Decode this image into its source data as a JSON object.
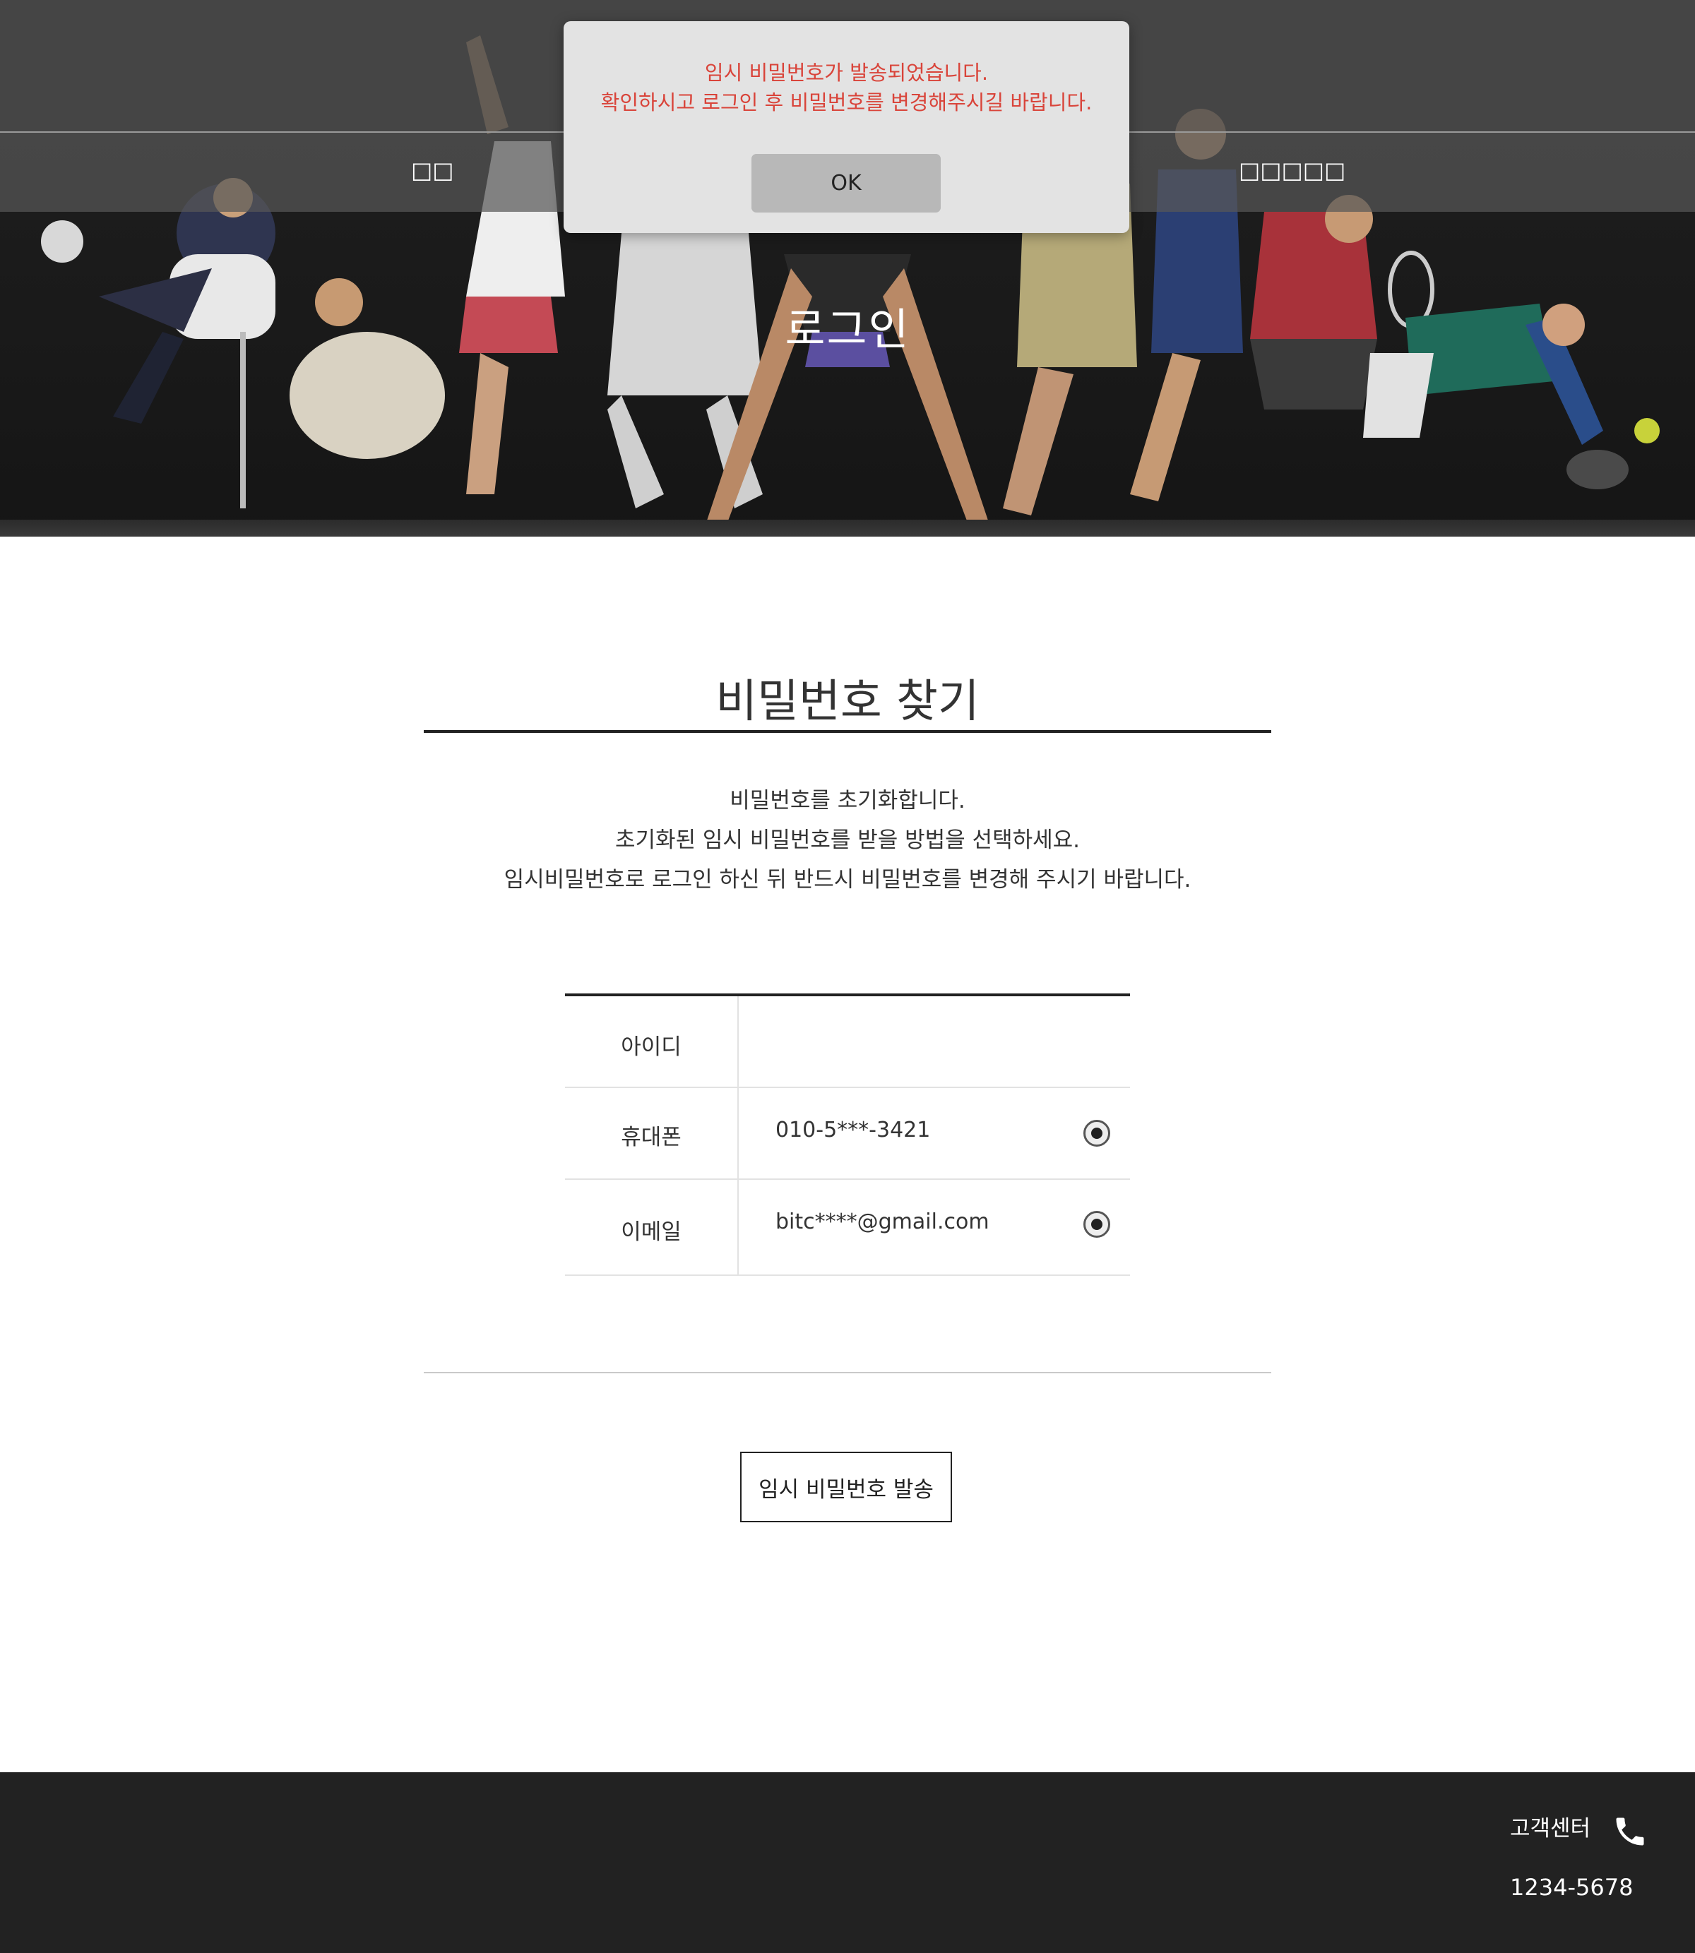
{
  "alert": {
    "line1": "임시 비밀번호가 발송되었습니다.",
    "line2": "확인하시고 로그인 후 비밀번호를 변경해주시길 바랍니다.",
    "ok_label": "OK",
    "text_color": "#d9443a"
  },
  "hero": {
    "title": "로그인",
    "nav": {
      "left_item": "□□",
      "right_item": "□□□□□"
    }
  },
  "main": {
    "title": "비밀번호 찾기",
    "description": [
      "비밀번호를 초기화합니다.",
      "초기화된 임시 비밀번호를 받을 방법을 선택하세요.",
      "임시비밀번호로 로그인 하신 뒤 반드시 비밀번호를 변경해 주시기 바랍니다."
    ],
    "form": {
      "id_label": "아이디",
      "id_value": "",
      "phone_label": "휴대폰",
      "phone_value": "010-5***-3421",
      "email_label": "이메일",
      "email_value": "bitc****@gmail.com"
    },
    "send_button": "임시 비밀번호 발송"
  },
  "footer": {
    "label": "고객센터",
    "icon": "phone-icon",
    "number": "1234-5678"
  }
}
